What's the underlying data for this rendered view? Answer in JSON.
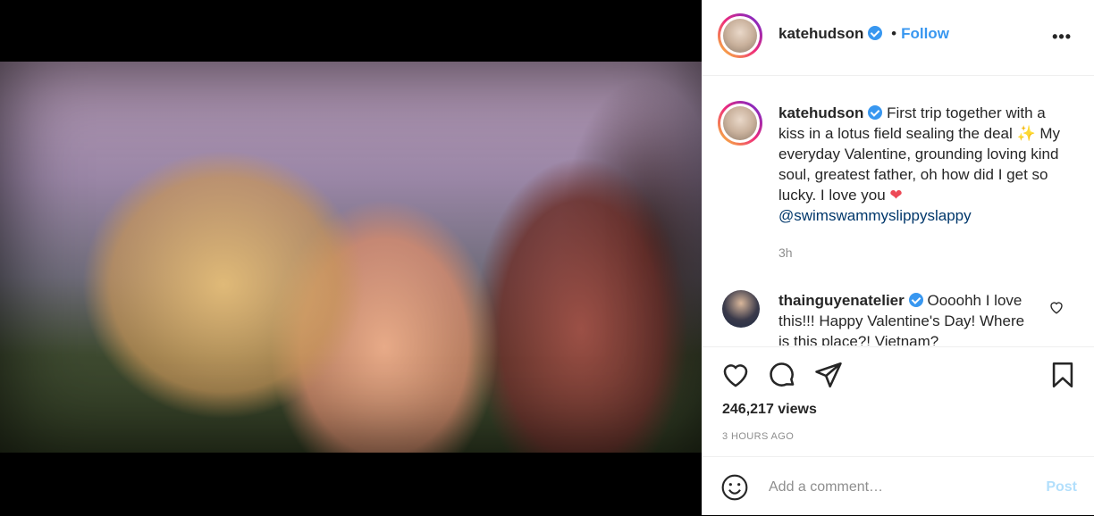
{
  "post": {
    "username": "katehudson",
    "follow_label": "Follow",
    "dot": "•",
    "more_label": "•••",
    "caption_pre": "First trip together with a kiss in a lotus field sealing the deal ",
    "caption_emoji": "✨",
    "caption_mid": " My everyday Valentine, grounding loving kind soul, greatest father, oh how did I get so lucky. I love you ",
    "caption_heart": "❤",
    "caption_mention": "@swimswammyslippyslappy",
    "caption_time": "3h"
  },
  "comment": {
    "username": "thainguyenatelier",
    "text": "Oooohh I love this!!! Happy Valentine's Day! Where is this place?! Vietnam?"
  },
  "stats": {
    "views": "246,217 views",
    "posted": "3 HOURS AGO"
  },
  "add_comment": {
    "placeholder": "Add a comment…",
    "post_label": "Post"
  },
  "icons": {
    "owner": "person-icon",
    "mute": "speaker-muted-icon",
    "like": "heart-icon",
    "comment": "comment-bubble-icon",
    "share": "paper-plane-icon",
    "save": "bookmark-icon",
    "emoji": "smiley-icon"
  },
  "colors": {
    "accent": "#3897f0",
    "post_disabled": "#b2dffc",
    "muted_text": "#8e8e8e",
    "heart": "#ed4956"
  }
}
